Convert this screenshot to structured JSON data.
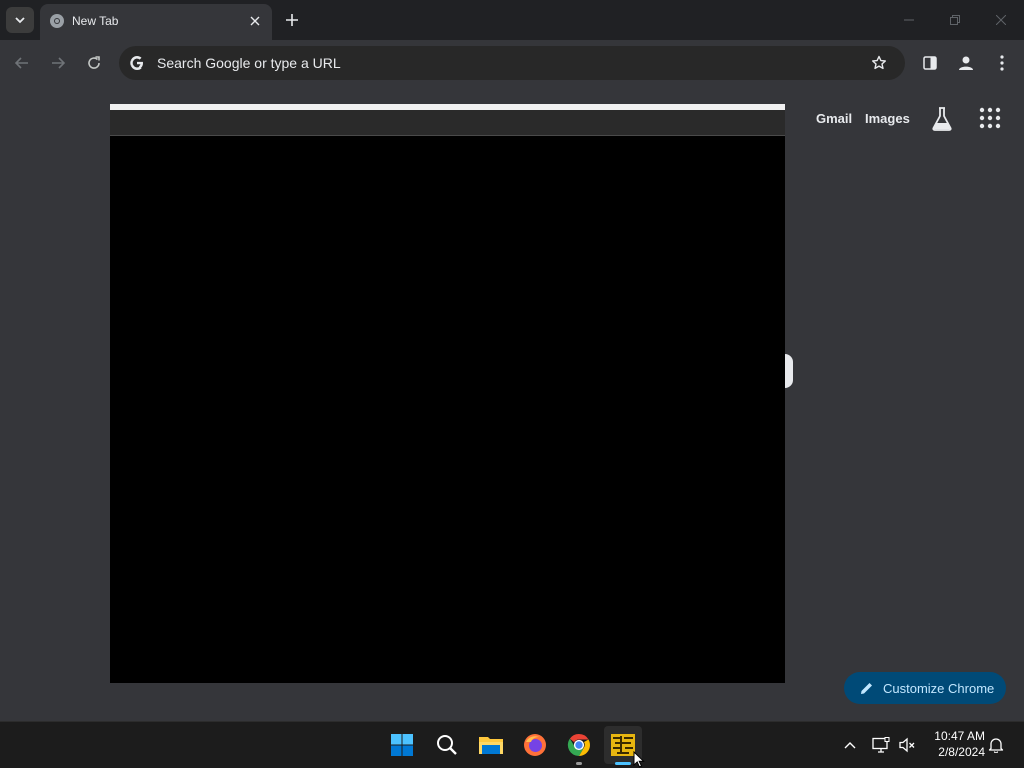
{
  "browser": {
    "tab": {
      "title": "New Tab"
    },
    "omnibox": {
      "placeholder": "Search Google or type a URL"
    }
  },
  "page": {
    "links": {
      "gmail": "Gmail",
      "images": "Images"
    },
    "customize_label": "Customize Chrome"
  },
  "taskbar": {
    "apps": [
      "start-icon",
      "search-icon",
      "file-explorer-icon",
      "firefox-icon",
      "chrome-icon",
      "app-icon"
    ],
    "clock": {
      "time": "10:47 AM",
      "date": "2/8/2024"
    }
  },
  "colors": {
    "background": "#202124",
    "toolbar": "#35363a",
    "page": "#35363a",
    "customize": "#004a77",
    "taskbar": "#1c1c1c"
  }
}
